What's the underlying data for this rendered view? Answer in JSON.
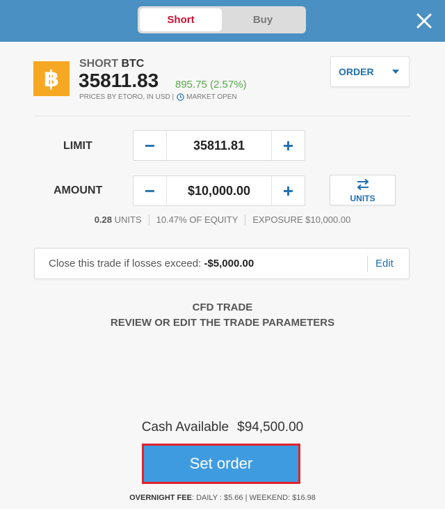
{
  "header": {
    "toggle": {
      "short_label": "Short",
      "buy_label": "Buy"
    },
    "close_icon": "close-icon",
    "accent_color": "#4a90c2"
  },
  "instrument": {
    "logo_icon": "bitcoin-icon",
    "side": "SHORT",
    "symbol": "BTC",
    "price": "35811.83",
    "change": "895.75 (2.57%)",
    "price_source": "PRICES BY ETORO, IN USD |",
    "market_status": "MARKET OPEN"
  },
  "order_dropdown": {
    "label": "ORDER"
  },
  "limit": {
    "label": "LIMIT",
    "value": "35811.81"
  },
  "amount": {
    "label": "AMOUNT",
    "value": "$10,000.00"
  },
  "units_button": {
    "label": "UNITS",
    "icon": "swap-icon"
  },
  "info": {
    "units_value": "0.28",
    "units_label": "UNITS",
    "equity": "10.47% OF EQUITY",
    "exposure": "EXPOSURE $10,000.00"
  },
  "stop_loss": {
    "text": "Close this trade if losses exceed:",
    "value": "-$5,000.00",
    "edit_label": "Edit"
  },
  "trade_type": {
    "line1": "CFD TRADE",
    "line2": "REVIEW OR EDIT THE TRADE PARAMETERS"
  },
  "cash": {
    "label": "Cash Available",
    "value": "$94,500.00"
  },
  "set_order_button": {
    "label": "Set order"
  },
  "fee": {
    "label": "OVERNIGHT FEE",
    "details": ": DAILY : $5.66 | WEEKEND: $16.98"
  }
}
